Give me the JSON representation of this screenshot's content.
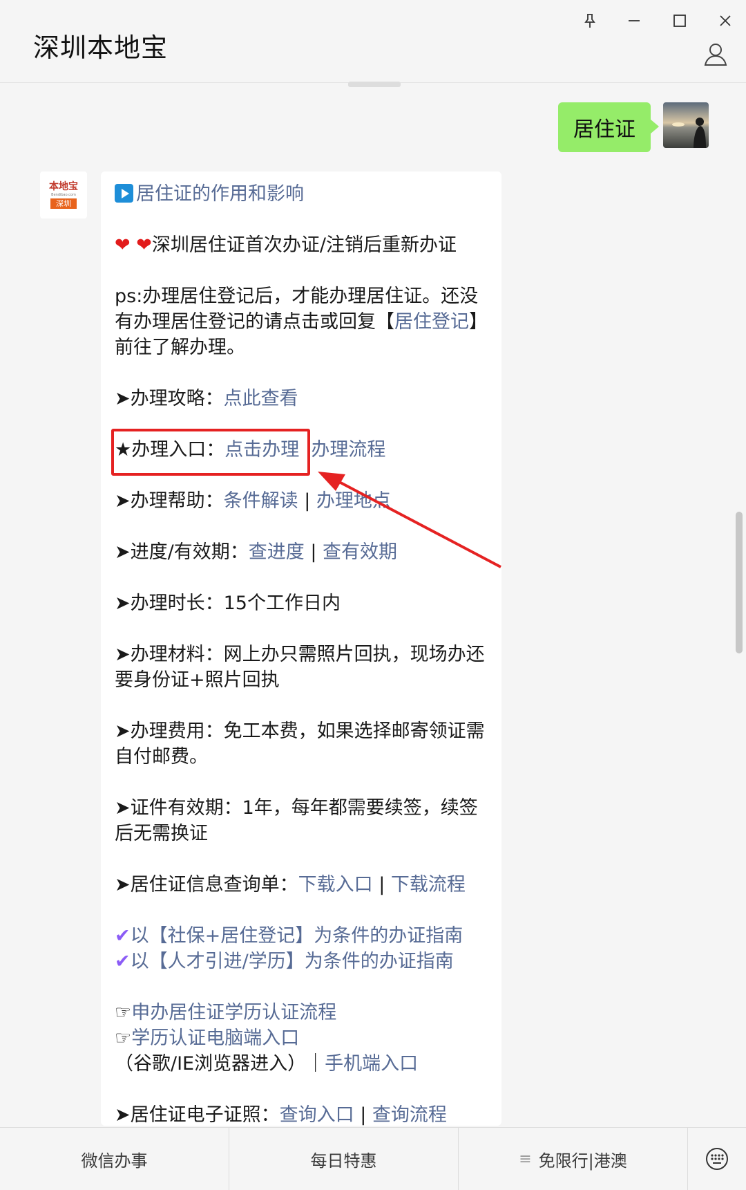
{
  "window": {
    "title": "深圳本地宝",
    "controls": [
      "pin-icon",
      "minimize-icon",
      "maximize-icon",
      "close-icon"
    ],
    "user_icon": "user-icon"
  },
  "chat": {
    "my_message": "居住证",
    "card": {
      "title": "居住证的作用和影响",
      "hearts": "❤ ❤",
      "first_time": "深圳居住证首次办证/注销后重新办证",
      "ps_text": "ps:办理居住登记后，才能办理居住证。还没有办理居住登记的请点击或回复【",
      "ps_link": "居住登记",
      "ps_tail": "】前往了解办理。",
      "strategy_label": "➤办理攻略：",
      "strategy_link": "点此查看",
      "entry_label": "★办理入口：",
      "entry_link": "点击办理",
      "entry_link2": "办理流程",
      "help_label": "➤办理帮助：",
      "help_link1": "条件解读",
      "separator": " | ",
      "help_link2": "办理地点",
      "progress_label": "➤进度/有效期：",
      "progress_link1": "查进度",
      "progress_link2": "查有效期",
      "duration": "➤办理时长：15个工作日内",
      "materials": "➤办理材料：网上办只需照片回执，现场办还要身份证+照片回执",
      "fees": "➤办理费用：免工本费，如果选择邮寄领证需自付邮费。",
      "validity": "➤证件有效期：1年，每年都需要续签，续签后无需换证",
      "query_label": "➤居住证信息查询单：",
      "query_link1": "下载入口",
      "query_link2": "下载流程",
      "guide1": "以【社保+居住登记】为条件的办证指南",
      "guide2": "以【人才引进/学历】为条件的办证指南",
      "pointer": "☞",
      "edu_link1": "申办居住证学历认证流程",
      "edu_link2": "学历认证电脑端入口",
      "edu_note": "（谷歌/IE浏览器进入）",
      "edu_sep": "｜",
      "edu_link3": "手机端入口",
      "ecert_label": "➤居住证电子证照：",
      "ecert_link1": "查询入口",
      "ecert_link2": "查询流程"
    }
  },
  "bottom_menu": {
    "tab1": "微信办事",
    "tab2": "每日特惠",
    "tab3": "免限行|港澳",
    "tab3_icon": "menu-icon",
    "keyboard_icon": "keyboard-icon"
  },
  "bot_logo": {
    "brand": "本地宝",
    "url": "Bendibao.com",
    "city": "深圳"
  },
  "colors": {
    "link": "#576b95",
    "bubble": "#95ec69",
    "annotation": "#e52222"
  }
}
